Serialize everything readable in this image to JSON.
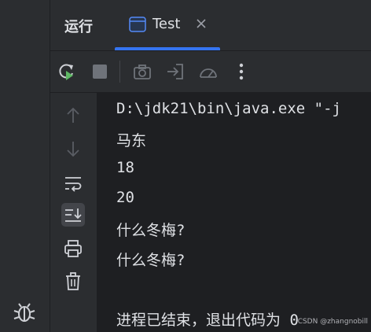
{
  "run_panel": {
    "title": "运行",
    "tab": {
      "label": "Test"
    }
  },
  "toolbar": {
    "buttons": [
      "rerun-icon",
      "stop-icon",
      "screenshot-icon",
      "restore-layout-icon",
      "profiler-icon",
      "more-options-icon"
    ]
  },
  "side_bar": {
    "buttons": [
      "up-arrow-icon",
      "down-arrow-icon",
      "soft-wrap-icon",
      "scroll-to-end-icon",
      "print-icon",
      "trash-icon"
    ]
  },
  "console": {
    "lines": [
      "D:\\jdk21\\bin\\java.exe \"-j",
      "马东",
      "18",
      "20",
      "什么冬梅?",
      "什么冬梅?",
      "",
      "进程已结束，退出代码为 0"
    ]
  },
  "watermark": "CSDN @zhangnobill",
  "colors": {
    "accent": "#3574f0",
    "background": "#1e1f22",
    "panel": "#2b2d30",
    "text": "#dfe1e5",
    "rerun_green": "#5fb865"
  }
}
